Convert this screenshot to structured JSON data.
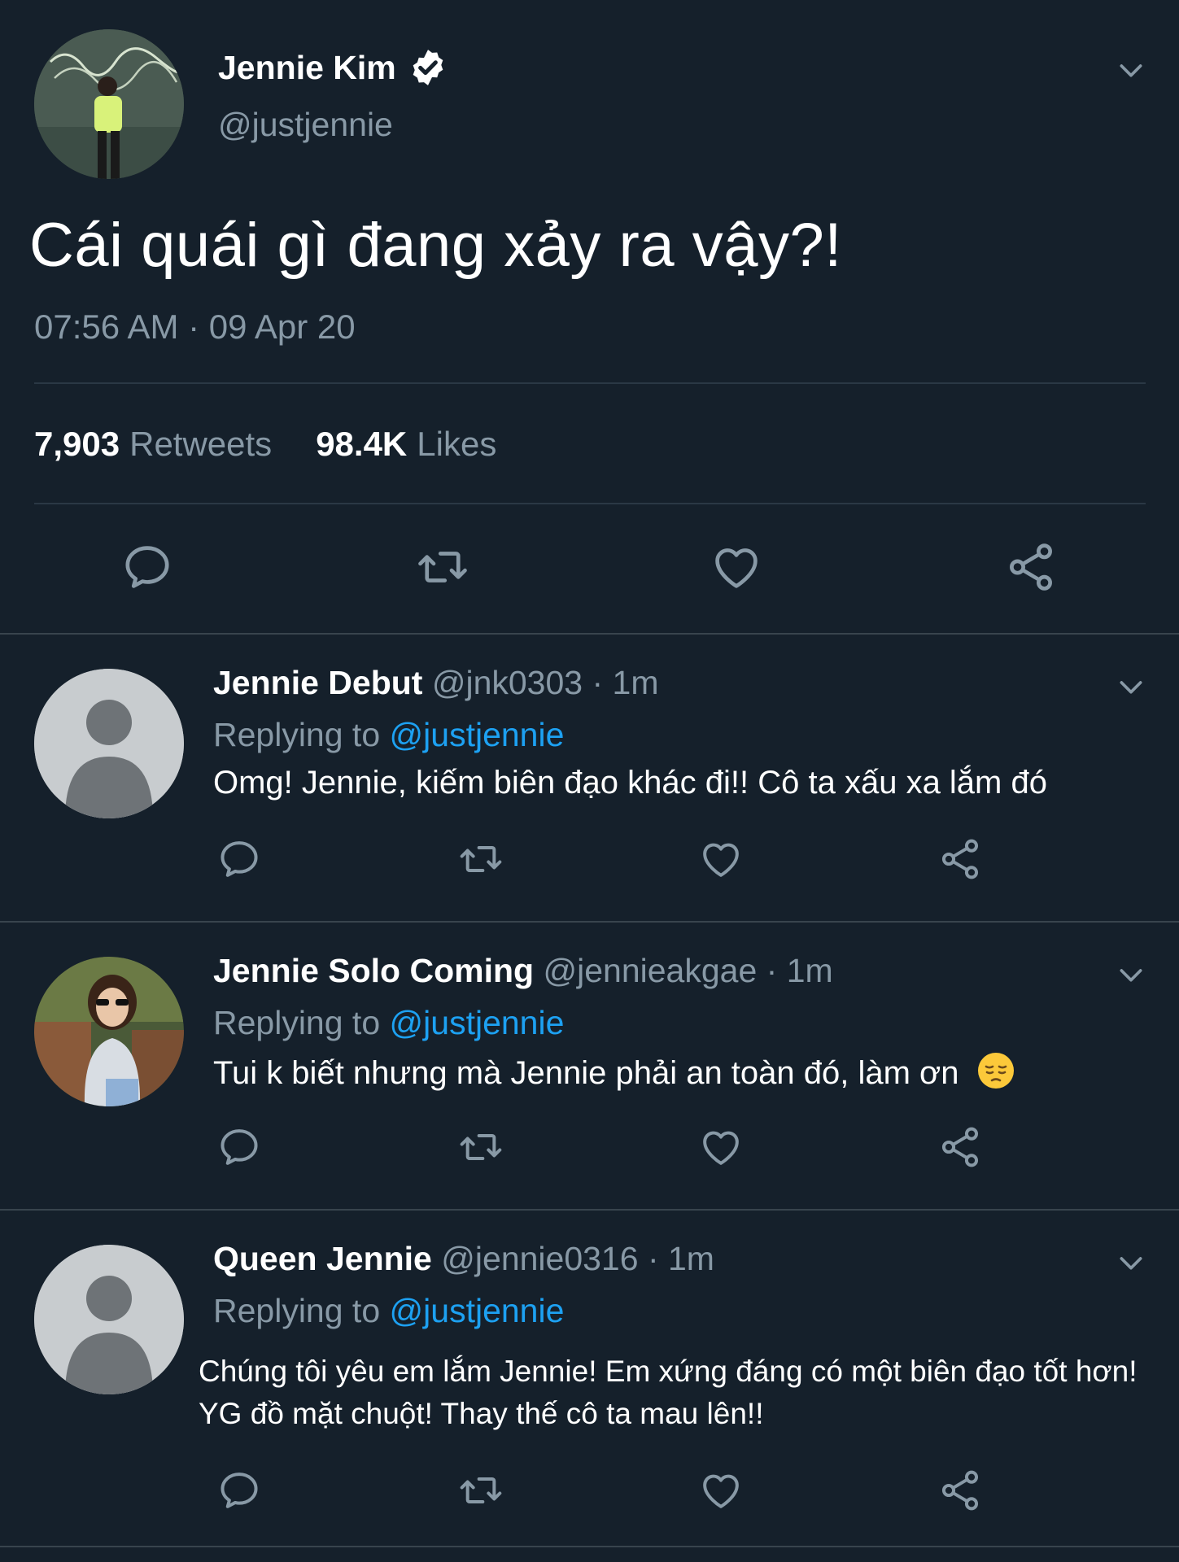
{
  "main_tweet": {
    "name": "Jennie Kim",
    "handle": "@justjennie",
    "text": "Cái quái gì đang xảy ra vậy?!",
    "time": "07:56 AM · 09 Apr 20",
    "retweets_count": "7,903",
    "retweets_label": "Retweets",
    "likes_count": "98.4K",
    "likes_label": "Likes"
  },
  "replies": [
    {
      "name": "Jennie Debut",
      "handle": "@jnk0303",
      "time": "· 1m",
      "replying_label": "Replying to",
      "replying_to": "@justjennie",
      "text": "Omg! Jennie, kiếm biên đạo khác đi!! Cô ta xấu xa lắm đó"
    },
    {
      "name": "Jennie Solo Coming",
      "handle": "@jennieakgae",
      "time": "· 1m",
      "replying_label": "Replying to",
      "replying_to": "@justjennie",
      "text": "Tui k biết nhưng mà Jennie phải an toàn đó, làm ơn"
    },
    {
      "name": "Queen Jennie",
      "handle": "@jennie0316",
      "time": "· 1m",
      "replying_label": "Replying to",
      "replying_to": "@justjennie",
      "text_line1": "Chúng tôi yêu em lắm Jennie! Em xứng đáng có một biên đạo tốt hơn!",
      "text_line2": "YG đồ mặt chuột! Thay thế cô ta mau lên!!"
    }
  ],
  "icons": [
    "reply-icon",
    "retweet-icon",
    "like-icon",
    "share-icon",
    "chevron-down-icon",
    "verified-badge-icon",
    "pensive-emoji"
  ],
  "colors": {
    "background": "#15202b",
    "secondary_text": "#8899a6",
    "link": "#1da1f2",
    "divider": "#38444d"
  }
}
